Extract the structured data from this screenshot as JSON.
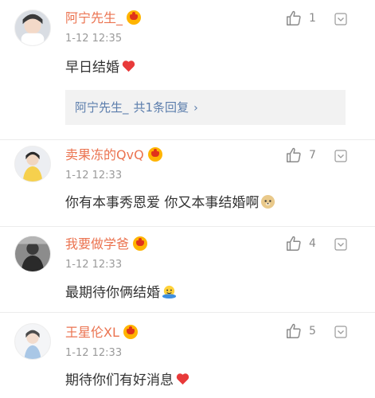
{
  "comments": [
    {
      "user": "阿宁先生_",
      "time": "1-12 12:35",
      "text": "早日结婚",
      "likes": "1",
      "reply": {
        "author": "阿宁先生_",
        "summary": "共1条回复",
        "arrow": "›"
      },
      "emoji": "heart-emoji"
    },
    {
      "user": "卖果冻的QvQ",
      "time": "1-12 12:33",
      "text": "你有本事秀恩爱  你又本事结婚啊",
      "likes": "7",
      "emoji": "doge-emoji"
    },
    {
      "user": "我要做学爸",
      "time": "1-12 12:33",
      "text": "最期待你俩结婚",
      "likes": "4",
      "emoji": "hug-emoji"
    },
    {
      "user": "王星伦XL",
      "time": "1-12 12:33",
      "text": "期待你们有好消息",
      "likes": "5",
      "emoji": "heart-emoji"
    }
  ],
  "colors": {
    "username": "#eb7350",
    "reply_link": "#5b7dac",
    "badge": "#ffb400",
    "heart": "#e83a3a"
  }
}
